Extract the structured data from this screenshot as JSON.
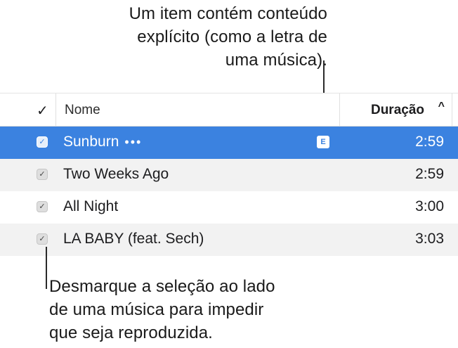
{
  "callouts": {
    "top": [
      "Um item contém conteúdo",
      "explícito (como a letra de",
      "uma música)."
    ],
    "bottom": [
      "Desmarque a seleção ao lado",
      "de uma música para impedir",
      "que seja reproduzida."
    ]
  },
  "header": {
    "check": "✓",
    "name": "Nome",
    "duration": "Duração",
    "sort_indicator": "^"
  },
  "rows": [
    {
      "title": "Sunburn",
      "more": "•••",
      "explicit_badge": "E",
      "duration": "2:59",
      "checked": "✓",
      "selected": true
    },
    {
      "title": "Two Weeks Ago",
      "duration": "2:59",
      "checked": "✓"
    },
    {
      "title": "All Night",
      "duration": "3:00",
      "checked": "✓"
    },
    {
      "title": "LA BABY (feat. Sech)",
      "duration": "3:03",
      "checked": "✓"
    }
  ],
  "colors": {
    "selection": "#3b82e0",
    "alt_row": "#f2f2f2"
  }
}
